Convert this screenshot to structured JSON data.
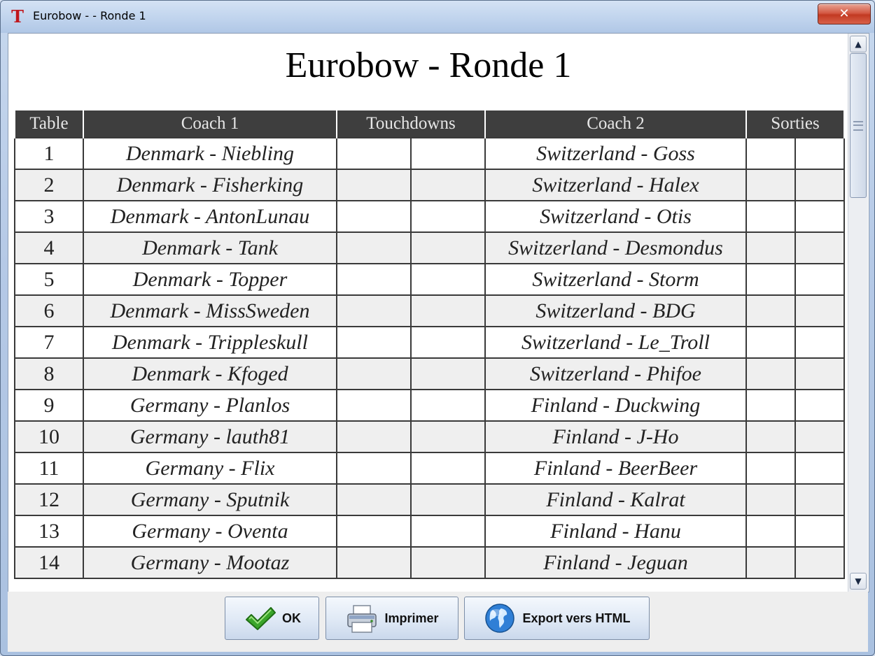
{
  "window": {
    "title": "Eurobow - - Ronde 1",
    "app_icon_glyph": "T",
    "close_glyph": "✕"
  },
  "report": {
    "heading": "Eurobow - Ronde 1",
    "columns": {
      "table": "Table",
      "coach1": "Coach 1",
      "touchdowns": "Touchdowns",
      "coach2": "Coach 2",
      "sorties": "Sorties"
    },
    "rows": [
      {
        "table": "1",
        "coach1": "Denmark - Niebling",
        "coach2": "Switzerland - Goss"
      },
      {
        "table": "2",
        "coach1": "Denmark - Fisherking",
        "coach2": "Switzerland - Halex"
      },
      {
        "table": "3",
        "coach1": "Denmark - AntonLunau",
        "coach2": "Switzerland - Otis"
      },
      {
        "table": "4",
        "coach1": "Denmark - Tank",
        "coach2": "Switzerland - Desmondus"
      },
      {
        "table": "5",
        "coach1": "Denmark - Topper",
        "coach2": "Switzerland - Storm"
      },
      {
        "table": "6",
        "coach1": "Denmark - MissSweden",
        "coach2": "Switzerland - BDG"
      },
      {
        "table": "7",
        "coach1": "Denmark - Trippleskull",
        "coach2": "Switzerland - Le_Troll"
      },
      {
        "table": "8",
        "coach1": "Denmark - Kfoged",
        "coach2": "Switzerland - Phifoe"
      },
      {
        "table": "9",
        "coach1": "Germany - Planlos",
        "coach2": "Finland - Duckwing"
      },
      {
        "table": "10",
        "coach1": "Germany - lauth81",
        "coach2": "Finland - J-Ho"
      },
      {
        "table": "11",
        "coach1": "Germany - Flix",
        "coach2": "Finland - BeerBeer"
      },
      {
        "table": "12",
        "coach1": "Germany - Sputnik",
        "coach2": "Finland - Kalrat"
      },
      {
        "table": "13",
        "coach1": "Germany - Oventa",
        "coach2": "Finland - Hanu"
      },
      {
        "table": "14",
        "coach1": "Germany - Mootaz",
        "coach2": "Finland - Jeguan"
      }
    ]
  },
  "scrollbar": {
    "up_glyph": "▲",
    "down_glyph": "▼"
  },
  "buttons": {
    "ok": {
      "label": "OK",
      "icon": "checkmark-icon"
    },
    "print": {
      "label": "Imprimer",
      "icon": "printer-icon"
    },
    "export": {
      "label": "Export vers HTML",
      "icon": "globe-icon"
    }
  },
  "colors": {
    "header_bg": "#3e3e3e",
    "header_text": "#e6e6e6",
    "alt_row": "#efefef",
    "check_green": "#3aa52a",
    "close_red": "#c23a22"
  }
}
